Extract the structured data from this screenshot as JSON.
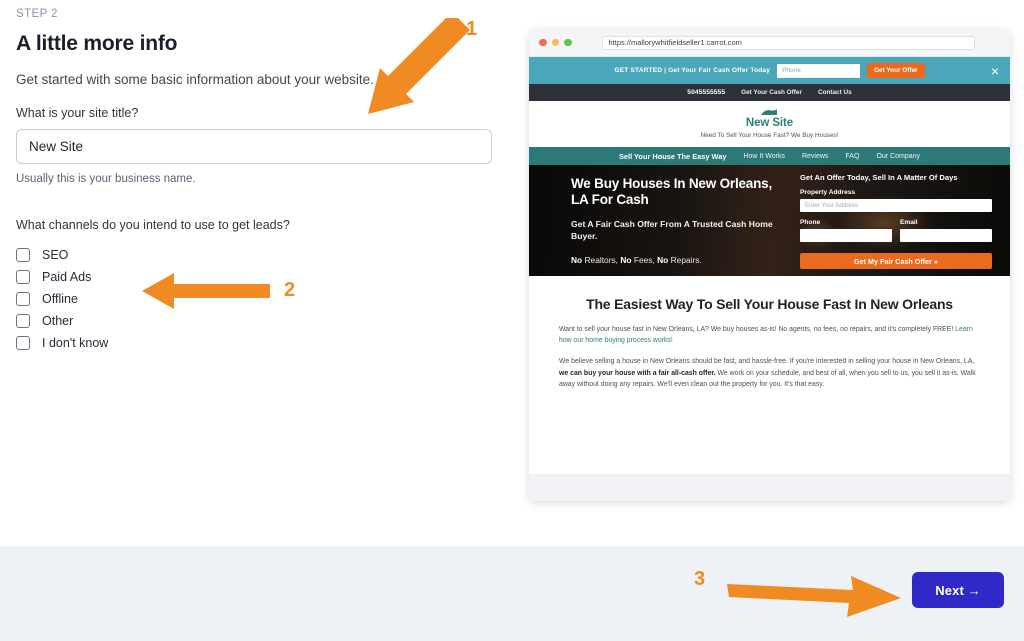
{
  "wizard": {
    "step_label": "STEP 2",
    "title": "A little more info",
    "subtitle": "Get started with some basic information about your website.",
    "site_title_label": "What is your site title?",
    "site_title_value": "New Site",
    "site_title_placeholder": "New Site",
    "site_title_hint": "Usually this is your business name.",
    "channels_label": "What channels do you intend to use to get leads?",
    "channels": [
      {
        "label": "SEO",
        "checked": false
      },
      {
        "label": "Paid Ads",
        "checked": false
      },
      {
        "label": "Offline",
        "checked": false
      },
      {
        "label": "Other",
        "checked": false
      },
      {
        "label": "I don't know",
        "checked": false
      }
    ],
    "next_label": "Next →"
  },
  "annotations": [
    {
      "number": "1"
    },
    {
      "number": "2"
    },
    {
      "number": "3"
    }
  ],
  "browser": {
    "url": "https://mallorywhitfieldseller1.carrot.com",
    "promo": {
      "text": "GET STARTED | Get Your Fair Cash Offer Today",
      "phone_placeholder": "Phone",
      "button": "Get Your Offer",
      "close": "×"
    },
    "contact_bar": {
      "phone": "5045555555",
      "links": [
        "Get Your Cash Offer",
        "Contact Us"
      ]
    },
    "logo": {
      "name": "New Site",
      "tagline": "Need To Sell Your House Fast? We Buy Houses!"
    },
    "nav": {
      "primary": "Sell Your House The Easy Way",
      "items": [
        "How It Works",
        "Reviews",
        "FAQ",
        "Our Company"
      ]
    },
    "hero": {
      "headline": "We Buy Houses In New Orleans, LA For Cash",
      "subhead": "Get A Fair Cash Offer From A Trusted Cash Home Buyer.",
      "tagline_no": "No",
      "tagline_rest_1": " Realtors, ",
      "tagline_rest_2": " Fees, ",
      "tagline_rest_3": " Repairs.",
      "form": {
        "title": "Get An Offer Today, Sell In A Matter Of Days",
        "address_label": "Property Address",
        "address_placeholder": "Enter Your Address",
        "phone_label": "Phone",
        "email_label": "Email",
        "submit": "Get My Fair Cash Offer »"
      }
    },
    "article": {
      "heading": "The Easiest Way To Sell Your House Fast In New Orleans",
      "p1_a": "Want to sell your house fast in New Orleans, LA? We buy houses as-is! No agents, no fees, no repairs, and it's completely FREE! ",
      "p1_link": "Learn how our home buying process works!",
      "p2_a": "We believe selling a house in New Orleans should be fast, and hassle-free. If you're interested in selling your house in New Orleans, LA, ",
      "p2_b": "we can buy your house with a fair all-cash offer.",
      "p2_c": " We work on your schedule, and best of all, when you sell to us, you sell it as-is. Walk away without doing any repairs. We'll even clean out the property for you. It's that easy."
    }
  },
  "colors": {
    "accent_orange": "#ea6a1e",
    "annotation_orange": "#ef8b22",
    "teal_promo": "#4aa7ba",
    "teal_nav": "#2b7a75",
    "dark_bar": "#2e3238",
    "next_blue": "#3128c8",
    "footer_bg": "#eef1f6"
  }
}
